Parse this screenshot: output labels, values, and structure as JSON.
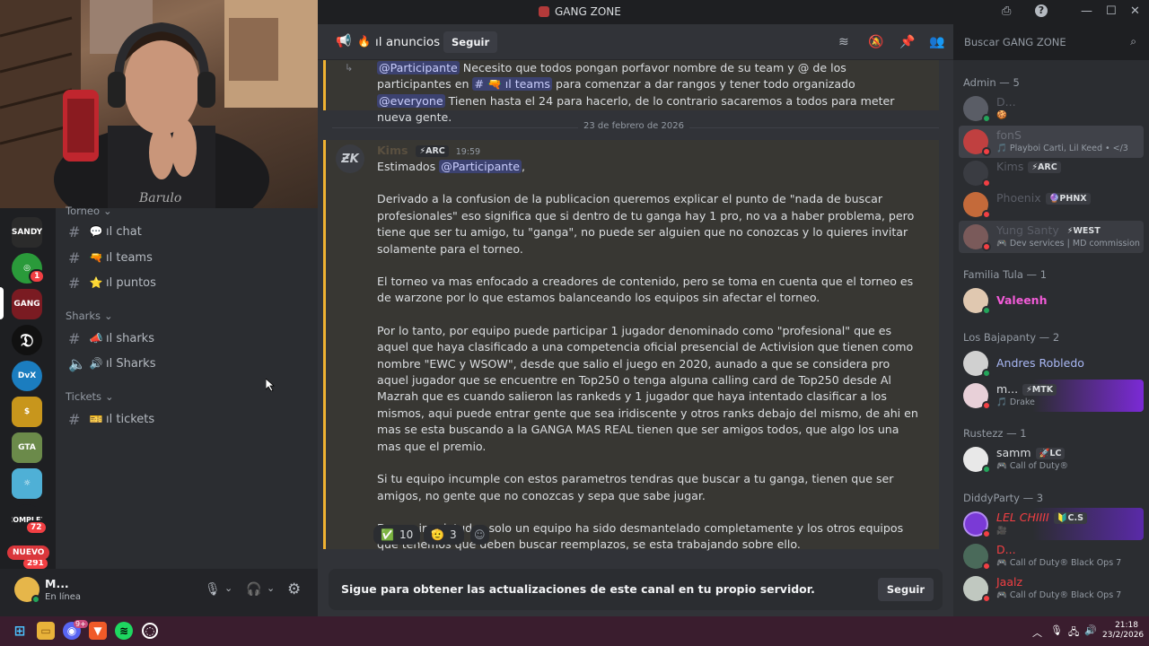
{
  "window": {
    "title": "GANG ZONE"
  },
  "servers": {
    "badges": [
      "1",
      "72",
      "291"
    ],
    "new_label": "NUEVO"
  },
  "sidebar": {
    "top_category": "Torneo",
    "channels_top": [
      {
        "emoji": "💬",
        "label": "chat"
      },
      {
        "emoji": "🔫",
        "label": "teams"
      },
      {
        "emoji": "⭐",
        "label": "puntos"
      }
    ],
    "sharks_category": "Sharks",
    "sharks_channels": [
      {
        "emoji": "📣",
        "label": "sharks"
      },
      {
        "emoji": "🔊",
        "label": "Sharks"
      }
    ],
    "tickets_category": "Tickets",
    "tickets_channels": [
      {
        "emoji": "🎫",
        "label": "tickets"
      }
    ]
  },
  "user": {
    "name": "M...",
    "status": "En línea"
  },
  "header": {
    "channel": "anuncios",
    "channel_prefix": "ıl",
    "follow": "Seguir",
    "search_placeholder": "Buscar GANG ZONE"
  },
  "messages": {
    "first": {
      "mention": "@Participante",
      "text1": "Necesito que todos pongan porfavor nombre de su team y @ de los participantes en",
      "channel_mention": "ıl teams",
      "text2": "para comenzar a dar rangos y tener todo organizado",
      "mention2": "@everyone",
      "text3": "Tienen hasta el 24 para hacerlo, de lo contrario sacaremos a todos para meter nueva gente."
    },
    "date_divider": "23 de febrero de 2026",
    "second": {
      "author": "Kims",
      "tag": "ARC",
      "time": "19:59",
      "greeting": "Estimados",
      "greeting_mention": "@Participante",
      "p1": "Derivado a la confusion de la publicacion queremos explicar el punto de \"nada de buscar profesionales\" eso significa que si dentro de tu ganga hay 1 pro, no va a haber problema, pero tiene que ser tu amigo, tu \"ganga\", no puede ser alguien que no conozcas y lo quieres invitar solamente para el torneo.",
      "p2": "El torneo va mas enfocado a creadores de contenido, pero se toma en cuenta que el torneo es de warzone por lo que estamos balanceando los equipos sin afectar el torneo.",
      "p3": "Por lo tanto, por equipo puede participar 1 jugador denominado como \"profesional\" que es aquel que haya clasificado a una competencia oficial presencial de Activision que tienen como nombre \"EWC y WSOW\", desde que salio el juego en 2020, aunado a que se considera pro aquel jugador que se encuentre en Top250 o tenga alguna calling card de Top250 desde Al Mazrah que es cuando salieron las rankeds y 1 jugador que haya intentado clasificar a los mismos, aqui puede entrar gente que sea iridiscente y otros ranks debajo del mismo, de ahi en mas se esta buscando a la GANGA MAS REAL tienen que ser amigos todos, que algo los una mas que el premio.",
      "p4": "Si tu equipo incumple con estos parametros tendras que buscar a tu ganga, tienen que ser amigos, no gente que no conozcas y sepa que sabe jugar.",
      "p5": "De sus inquietudes solo un equipo ha sido desmantelado completamente y los otros equipos que tenemos que deben buscar reemplazos, se esta trabajando sobre ello.",
      "reactions": [
        {
          "emoji": "✅",
          "count": "10"
        },
        {
          "emoji": "🫡",
          "count": "3"
        }
      ]
    }
  },
  "footer": {
    "text": "Sigue para obtener las actualizaciones de este canal en tu propio servidor.",
    "button": "Seguir"
  },
  "members": {
    "groups": [
      {
        "title": "Admin — 5",
        "items": [
          {
            "name": "D...",
            "sub": "🍪",
            "tag": "",
            "color": "#c8c2bd"
          },
          {
            "name": "fonS",
            "sub": "🎵 Playboi Carti, Lil Keed • </3",
            "tag": "",
            "color": "#f2e8e4"
          },
          {
            "name": "Kims",
            "sub": "",
            "tag": "⚡ARC",
            "color": "#f5c6c6"
          },
          {
            "name": "Phoenix",
            "sub": "",
            "tag": "🔮PHNX",
            "color": "#f0b8a8"
          },
          {
            "name": "Yung Santy",
            "sub": "🎮 Dev services | MD commissions",
            "tag": "⚡WEST",
            "color": "#e6e2b8"
          }
        ]
      },
      {
        "title": "Familia Tula — 1",
        "items": [
          {
            "name": "Valeenh",
            "sub": "",
            "tag": "",
            "color": "#f15bd7"
          }
        ]
      },
      {
        "title": "Los Bajapanty — 2",
        "items": [
          {
            "name": "Andres Robledo",
            "sub": "",
            "tag": "",
            "color": "#a9b8f5"
          },
          {
            "name": "m...",
            "sub": "🎵 Drake",
            "tag": "⚡MTK",
            "color": "#dbdee1"
          }
        ]
      },
      {
        "title": "Rustezz — 1",
        "items": [
          {
            "name": "samm",
            "sub": "🎮 Call of Duty®",
            "tag": "🚀LC",
            "color": "#dbdee1"
          }
        ]
      },
      {
        "title": "DiddyParty — 3",
        "items": [
          {
            "name": "LEL CHIIII",
            "sub": "🎥",
            "tag": "🔰C.S",
            "color": "#f23f43"
          },
          {
            "name": "D...",
            "sub": "🎮 Call of Duty® Black Ops 7",
            "tag": "",
            "color": "#f23f43"
          },
          {
            "name": "Jaalz",
            "sub": "🎮 Call of Duty® Black Ops 7",
            "tag": "",
            "color": "#f23f43"
          }
        ]
      }
    ]
  },
  "taskbar": {
    "time": "21:18",
    "date": "23/2/2026",
    "discord_badge": "9+"
  }
}
